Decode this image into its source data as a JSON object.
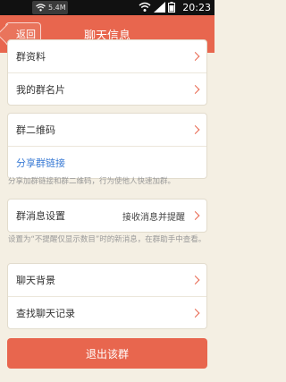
{
  "status_bar": {
    "time": "20:23",
    "wifi_label": "5.4M",
    "icons": [
      "wifi-icon",
      "signal-icon",
      "battery-icon"
    ]
  },
  "header": {
    "back_label": "返回",
    "title": "聊天信息"
  },
  "group1": {
    "items": [
      {
        "label": "群资料"
      },
      {
        "label": "我的群名片"
      }
    ]
  },
  "group2": {
    "qr_label": "群二维码",
    "share_link_label": "分享群链接",
    "hint": "分享加群链接和群二维码，行为使他人快速加群。"
  },
  "group3": {
    "setting_label": "群消息设置",
    "setting_value": "接收消息并提醒",
    "hint": "设置为“不提醒仅显示数目”时的新消息，在群助手中查看。"
  },
  "group4": {
    "items": [
      {
        "label": "聊天背景"
      },
      {
        "label": "查找聊天记录"
      }
    ]
  },
  "exit_button": "退出该群",
  "colors": {
    "accent": "#e8664e",
    "link": "#3a7bd5",
    "background": "#f4efe3"
  }
}
